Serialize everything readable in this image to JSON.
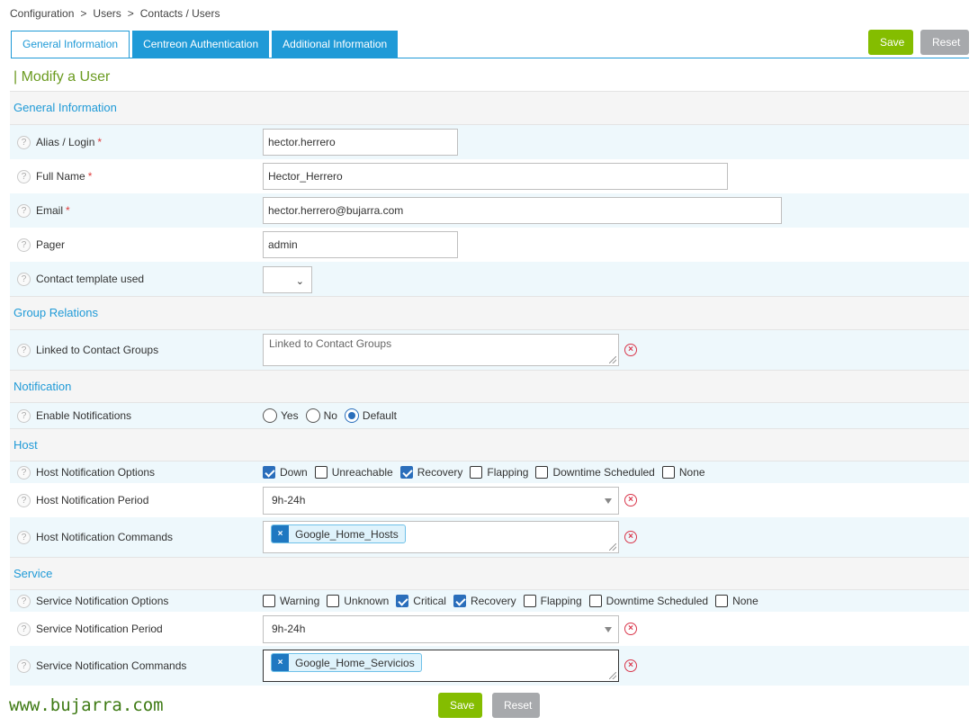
{
  "breadcrumb": [
    "Configuration",
    "Users",
    "Contacts / Users"
  ],
  "breadcrumb_sep": ">",
  "tabs": [
    "General Information",
    "Centreon Authentication",
    "Additional Information"
  ],
  "actions": {
    "save": "Save",
    "reset": "Reset"
  },
  "form_title": "| Modify a User",
  "sections": {
    "general": "General Information",
    "group": "Group Relations",
    "notification": "Notification",
    "host": "Host",
    "service": "Service"
  },
  "fields": {
    "alias": {
      "label": "Alias / Login",
      "value": "hector.herrero"
    },
    "fullname": {
      "label": "Full Name",
      "value": "Hector_Herrero"
    },
    "email": {
      "label": "Email",
      "value": "hector.herrero@bujarra.com"
    },
    "pager": {
      "label": "Pager",
      "value": "admin"
    },
    "template": {
      "label": "Contact template used",
      "value": ""
    },
    "contact_groups": {
      "label": "Linked to Contact Groups",
      "placeholder": "Linked to Contact Groups"
    },
    "enable_notif": {
      "label": "Enable Notifications",
      "options": [
        "Yes",
        "No",
        "Default"
      ],
      "selected": "Default"
    },
    "host_options": {
      "label": "Host Notification Options",
      "options": [
        "Down",
        "Unreachable",
        "Recovery",
        "Flapping",
        "Downtime Scheduled",
        "None"
      ],
      "checked": [
        true,
        false,
        true,
        false,
        false,
        false
      ]
    },
    "host_period": {
      "label": "Host Notification Period",
      "value": "9h-24h"
    },
    "host_commands": {
      "label": "Host Notification Commands",
      "tags": [
        "Google_Home_Hosts"
      ]
    },
    "service_options": {
      "label": "Service Notification Options",
      "options": [
        "Warning",
        "Unknown",
        "Critical",
        "Recovery",
        "Flapping",
        "Downtime Scheduled",
        "None"
      ],
      "checked": [
        false,
        false,
        true,
        true,
        false,
        false,
        false
      ]
    },
    "service_period": {
      "label": "Service Notification Period",
      "value": "9h-24h"
    },
    "service_commands": {
      "label": "Service Notification Commands",
      "tags": [
        "Google_Home_Servicios"
      ]
    }
  },
  "required_mark": "*",
  "help_glyph": "?",
  "remove_glyph": "×",
  "watermark": "www.bujarra.com",
  "colors": {
    "accent": "#1f9ad7",
    "save": "#84bd00",
    "reset": "#a7a9ac",
    "title": "#6a9a1f",
    "remove": "#d9364b"
  }
}
